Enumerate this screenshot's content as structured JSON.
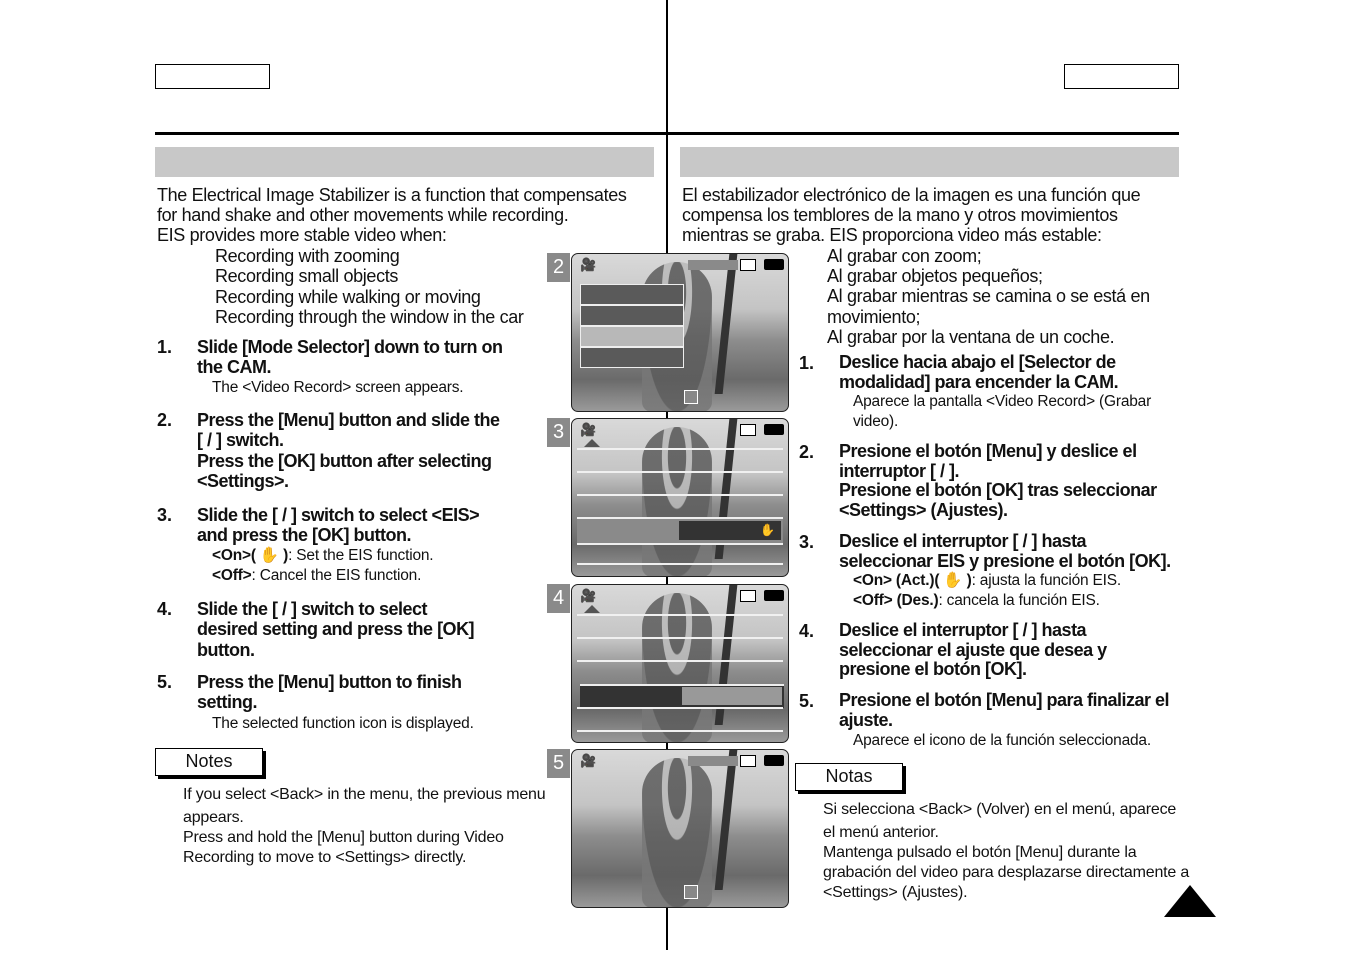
{
  "left": {
    "intro": [
      "The Electrical Image Stabilizer is a function that compensates",
      "for hand shake and other movements while recording.",
      "EIS provides more stable video when:"
    ],
    "bullets": [
      "Recording with zooming",
      "Recording small objects",
      "Recording while walking or moving",
      "Recording through the window in the car"
    ],
    "steps": [
      {
        "num": "1.",
        "lines": [
          "Slide [Mode Selector] down to turn on",
          "the CAM."
        ],
        "sub": [
          "The <Video Record> screen appears."
        ]
      },
      {
        "num": "2.",
        "lines": [
          "Press the [Menu] button and slide the",
          "[    /    ] switch.",
          "Press the [OK] button after selecting",
          "<Settings>."
        ],
        "sub": []
      },
      {
        "num": "3.",
        "lines": [
          "Slide the [    /    ] switch to select <EIS>",
          "and press the [OK] button."
        ],
        "sub": [
          {
            "b": "<On>(",
            "icon": "hand-icon",
            "b2": ")",
            "r": ": Set the EIS function."
          },
          {
            "b": "<Off>",
            "r": ": Cancel the EIS function."
          }
        ]
      },
      {
        "num": "4.",
        "lines": [
          "Slide the [    /    ] switch to select",
          "desired setting and press the [OK]",
          "button."
        ],
        "sub": []
      },
      {
        "num": "5.",
        "lines": [
          "Press the [Menu] button to finish",
          "setting."
        ],
        "sub": [
          "The selected function icon is displayed."
        ]
      }
    ],
    "notes_label": "Notes",
    "notes": [
      "If you select <Back> in the menu, the previous menu",
      "appears.",
      "Press and hold the [Menu] button during Video",
      "Recording to move to <Settings> directly."
    ]
  },
  "right": {
    "intro": [
      "El estabilizador electrónico de la imagen es una función que",
      "compensa los temblores de la mano y otros movimientos",
      "mientras se graba. EIS proporciona video más estable:"
    ],
    "bullets": [
      "Al grabar con zoom;",
      "Al grabar objetos pequeños;",
      "Al grabar mientras se camina o se está en",
      "movimiento;",
      "Al grabar por la ventana de un coche."
    ],
    "steps": [
      {
        "num": "1.",
        "lines": [
          "Deslice hacia abajo el [Selector de",
          "modalidad] para encender la CAM."
        ],
        "sub": [
          "Aparece la pantalla <Video Record> (Grabar",
          "video)."
        ]
      },
      {
        "num": "2.",
        "lines": [
          "Presione el botón [Menu] y deslice el",
          "interruptor [    /    ].",
          "Presione el botón [OK] tras seleccionar",
          "<Settings> (Ajustes)."
        ],
        "sub": []
      },
      {
        "num": "3.",
        "lines": [
          "Deslice el interruptor [    /    ] hasta",
          "seleccionar EIS y presione el botón [OK]."
        ],
        "sub": [
          {
            "b": "<On> (Act.)(",
            "icon": "hand-icon",
            "b2": ")",
            "r": ": ajusta la función EIS."
          },
          {
            "b": "<Off> (Des.)",
            "r": ": cancela la función EIS."
          }
        ]
      },
      {
        "num": "4.",
        "lines": [
          "Deslice el interruptor [    /    ] hasta",
          "seleccionar el ajuste que desea y",
          "presione el botón [OK]."
        ],
        "sub": []
      },
      {
        "num": "5.",
        "lines": [
          "Presione el botón [Menu] para finalizar el",
          "ajuste."
        ],
        "sub": [
          "Aparece el icono de la función seleccionada."
        ]
      }
    ],
    "notes_label": "Notas",
    "notes": [
      "Si selecciona <Back> (Volver) en el menú, aparece",
      "el menú anterior.",
      "Mantenga pulsado el botón [Menu] durante la",
      "grabación del video para desplazarse directamente a",
      "<Settings> (Ajustes)."
    ]
  },
  "screens": [
    {
      "step": "2"
    },
    {
      "step": "3"
    },
    {
      "step": "4"
    },
    {
      "step": "5"
    }
  ]
}
